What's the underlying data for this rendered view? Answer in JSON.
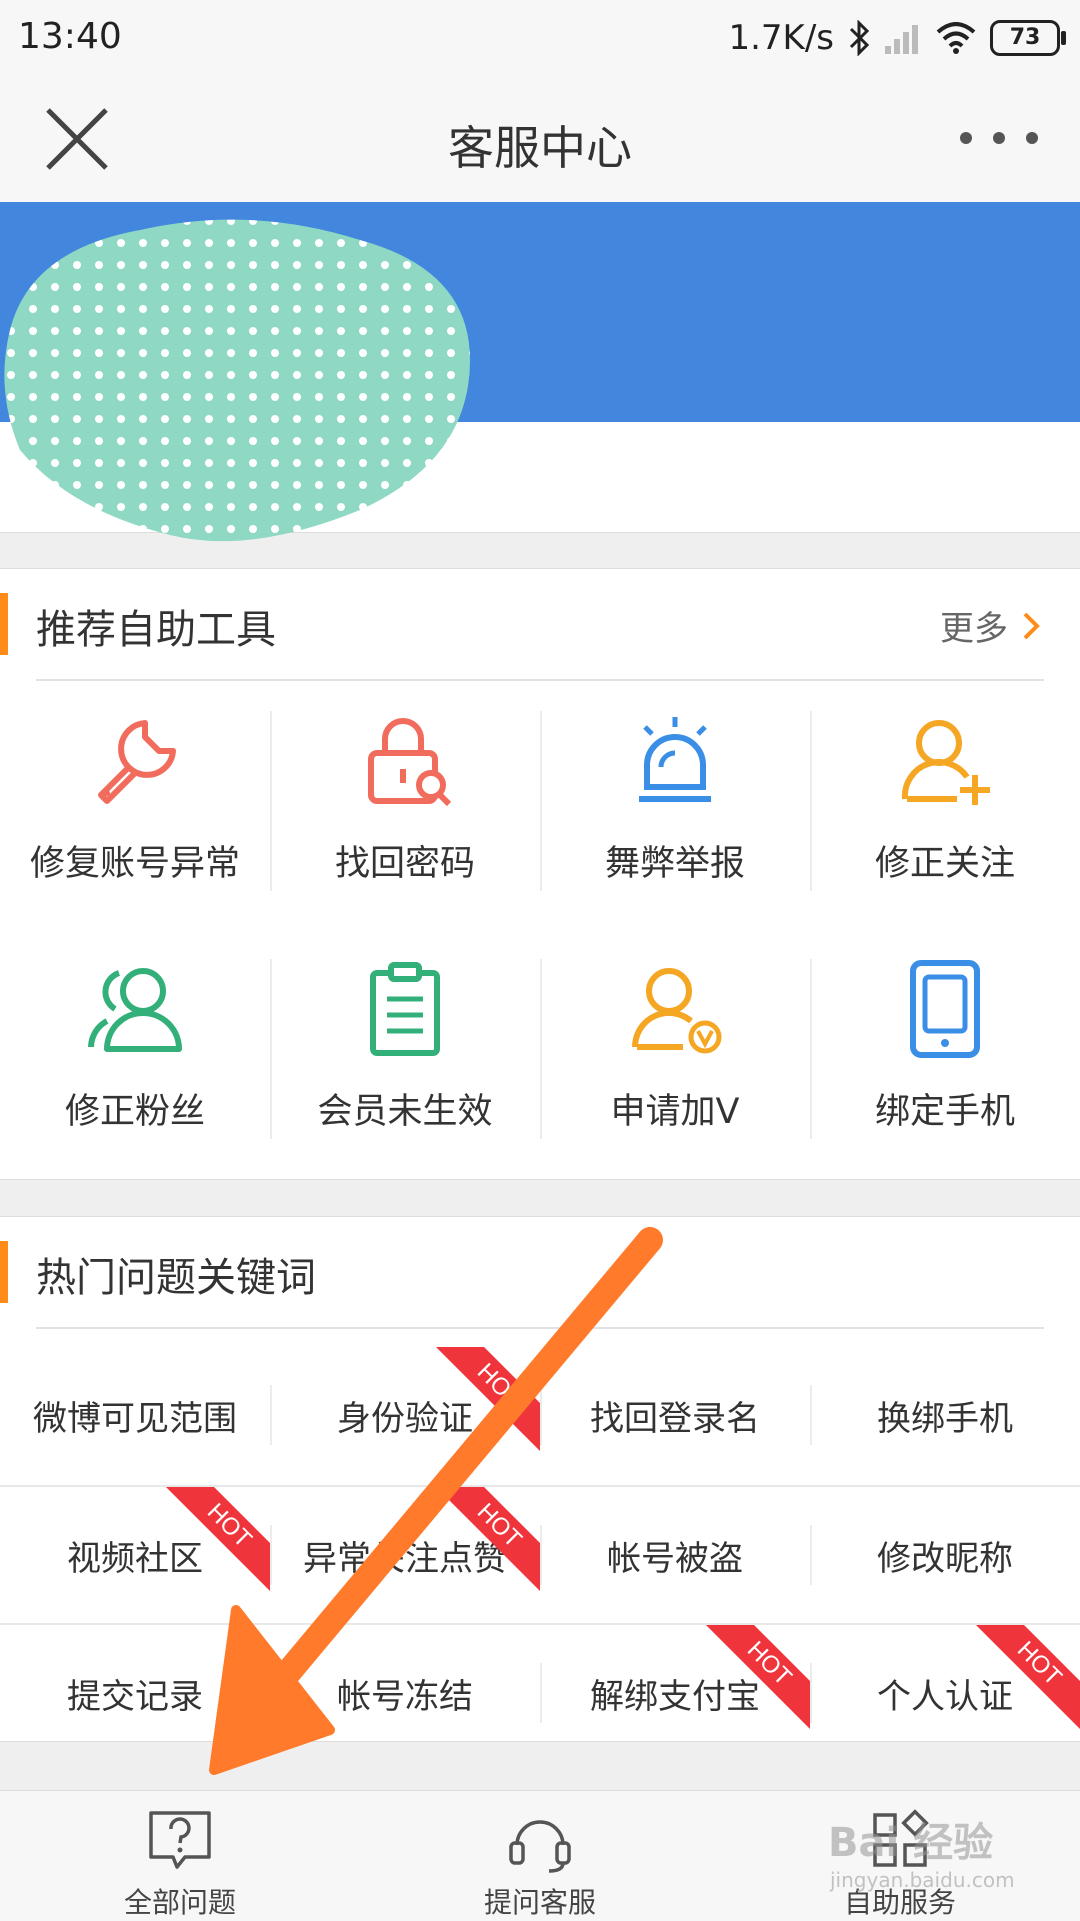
{
  "status_bar": {
    "time": "13:40",
    "net_speed": "1.7K/s",
    "battery": "73",
    "icons": [
      "bluetooth-icon",
      "signal-icon",
      "wifi-icon",
      "battery-icon"
    ]
  },
  "nav": {
    "title": "客服中心",
    "close_icon": "close-icon",
    "more_icon": "more-dots-icon"
  },
  "tools_section": {
    "title": "推荐自助工具",
    "more_label": "更多",
    "items": [
      {
        "label": "修复账号异常",
        "icon": "wrench-icon",
        "color": "#f26c5d"
      },
      {
        "label": "找回密码",
        "icon": "lock-search-icon",
        "color": "#f26c5d"
      },
      {
        "label": "舞弊举报",
        "icon": "alarm-icon",
        "color": "#3a8ee6"
      },
      {
        "label": "修正关注",
        "icon": "user-add-icon",
        "color": "#f5a623"
      },
      {
        "label": "修正粉丝",
        "icon": "users-icon",
        "color": "#33b07a"
      },
      {
        "label": "会员未生效",
        "icon": "clipboard-icon",
        "color": "#33b07a"
      },
      {
        "label": "申请加V",
        "icon": "user-verified-icon",
        "color": "#f5a623"
      },
      {
        "label": "绑定手机",
        "icon": "phone-icon",
        "color": "#3a8ee6"
      }
    ]
  },
  "hot_section": {
    "title": "热门问题关键词",
    "hot_badge": "HOT",
    "keywords": [
      {
        "label": "微博可见范围",
        "hot": false
      },
      {
        "label": "身份验证",
        "hot": true
      },
      {
        "label": "找回登录名",
        "hot": false
      },
      {
        "label": "换绑手机",
        "hot": false
      },
      {
        "label": "视频社区",
        "hot": true
      },
      {
        "label": "异常关注点赞",
        "hot": true
      },
      {
        "label": "帐号被盗",
        "hot": false
      },
      {
        "label": "修改昵称",
        "hot": false
      },
      {
        "label": "提交记录",
        "hot": false
      },
      {
        "label": "帐号冻结",
        "hot": false
      },
      {
        "label": "解绑支付宝",
        "hot": true
      },
      {
        "label": "个人认证",
        "hot": true
      }
    ]
  },
  "tab_bar": {
    "items": [
      {
        "label": "全部问题",
        "icon": "question-bubble-icon"
      },
      {
        "label": "提问客服",
        "icon": "headset-icon"
      },
      {
        "label": "自助服务",
        "icon": "grid-icon"
      }
    ]
  },
  "watermark": {
    "text": "Bai 经验",
    "sub": "jingyan.baidu.com"
  },
  "colors": {
    "banner": "#4286dd",
    "accent": "#ff8c1a",
    "hot": "#f0343c",
    "arrow": "#ff7a2a"
  }
}
